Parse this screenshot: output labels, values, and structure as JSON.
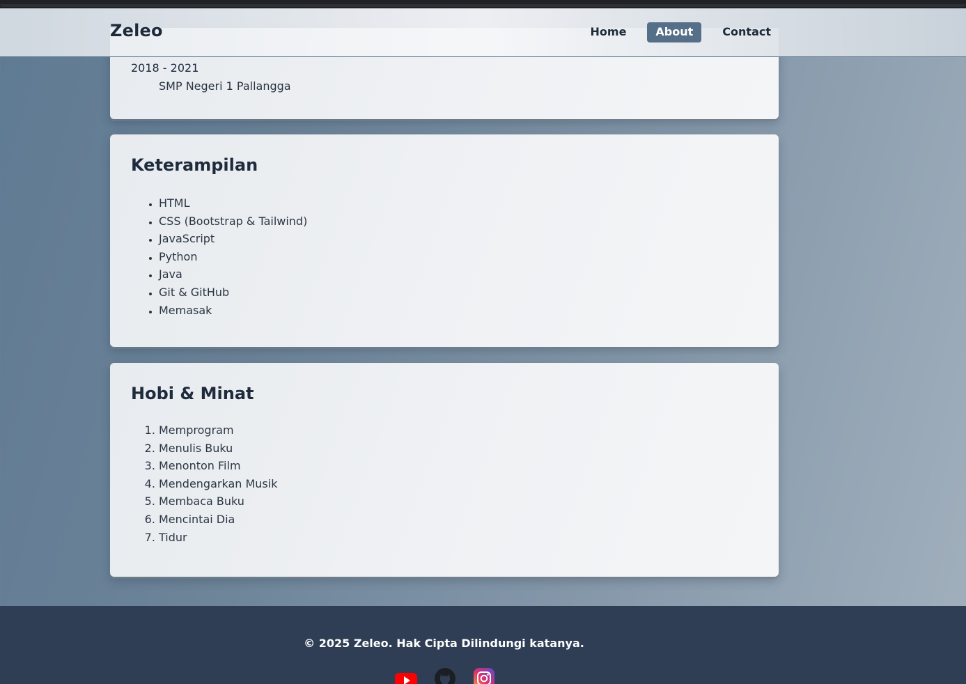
{
  "navbar": {
    "brand": "Zeleo",
    "links": [
      {
        "label": "Home"
      },
      {
        "label": "About",
        "active": true
      },
      {
        "label": "Contact"
      }
    ]
  },
  "education": {
    "years": "2018 - 2021",
    "school": "SMP Negeri 1 Pallangga"
  },
  "skills": {
    "title": "Keterampilan",
    "items": [
      "HTML",
      "CSS (Bootstrap & Tailwind)",
      "JavaScript",
      "Python",
      "Java",
      "Git & GitHub",
      "Memasak"
    ]
  },
  "hobbies": {
    "title": "Hobi & Minat",
    "items": [
      "Memprogram",
      "Menulis Buku",
      "Menonton Film",
      "Mendengarkan Musik",
      "Membaca Buku",
      "Mencintai Dia",
      "Tidur"
    ]
  },
  "footer": {
    "copyright": "© 2025 Zeleo. Hak Cipta Dilindungi katanya.",
    "socials": [
      "youtube-icon",
      "github-icon",
      "instagram-icon"
    ]
  },
  "colors": {
    "primary_text": "#1e2b3c",
    "nav_active": "#566f88",
    "footer_bg": "#2f3e55",
    "youtube": "#ff0000"
  }
}
